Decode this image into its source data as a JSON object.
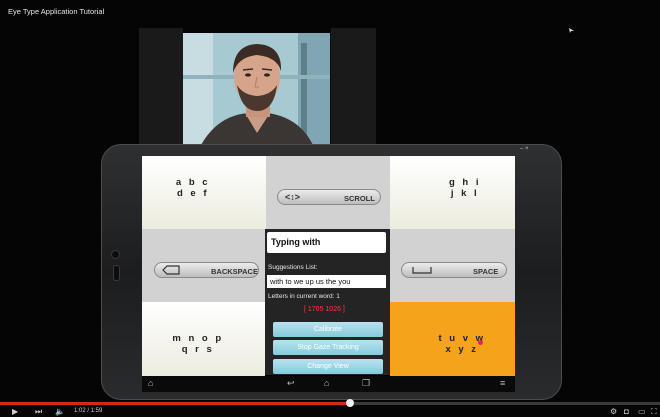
{
  "video": {
    "title": "Eye Type Application Tutorial",
    "time": "1:02 / 1:59",
    "progress": 0.53
  },
  "keyboard": {
    "top_left_letters": [
      "a b c",
      "d e f"
    ],
    "top_right_letters": [
      "g h i",
      "j k l"
    ],
    "bottom_left_letters": [
      "m n o p",
      "q r s"
    ],
    "bottom_right_letters": [
      "t u v w",
      "x y z"
    ],
    "scroll_label": "SCROLL",
    "scroll_glyph": "<↕>",
    "backspace_label": "BACKSPACE",
    "space_label": "SPACE"
  },
  "panel": {
    "typing_text": "Typing with",
    "suggestions_label": "Suggestions List:",
    "suggestions_text": "with to we up us the you",
    "letters_label": "Letters in current word: 1",
    "coords": "[ 1705 1026 ]",
    "calibrate_label": "Calibrate",
    "stop_gaze_label": "Stop Gaze Tracking",
    "change_view_label": "Change View"
  },
  "colors": {
    "selected_cell": "#f5a31b",
    "progress_red": "#d7261e",
    "button_blue": "#86cbdc"
  }
}
